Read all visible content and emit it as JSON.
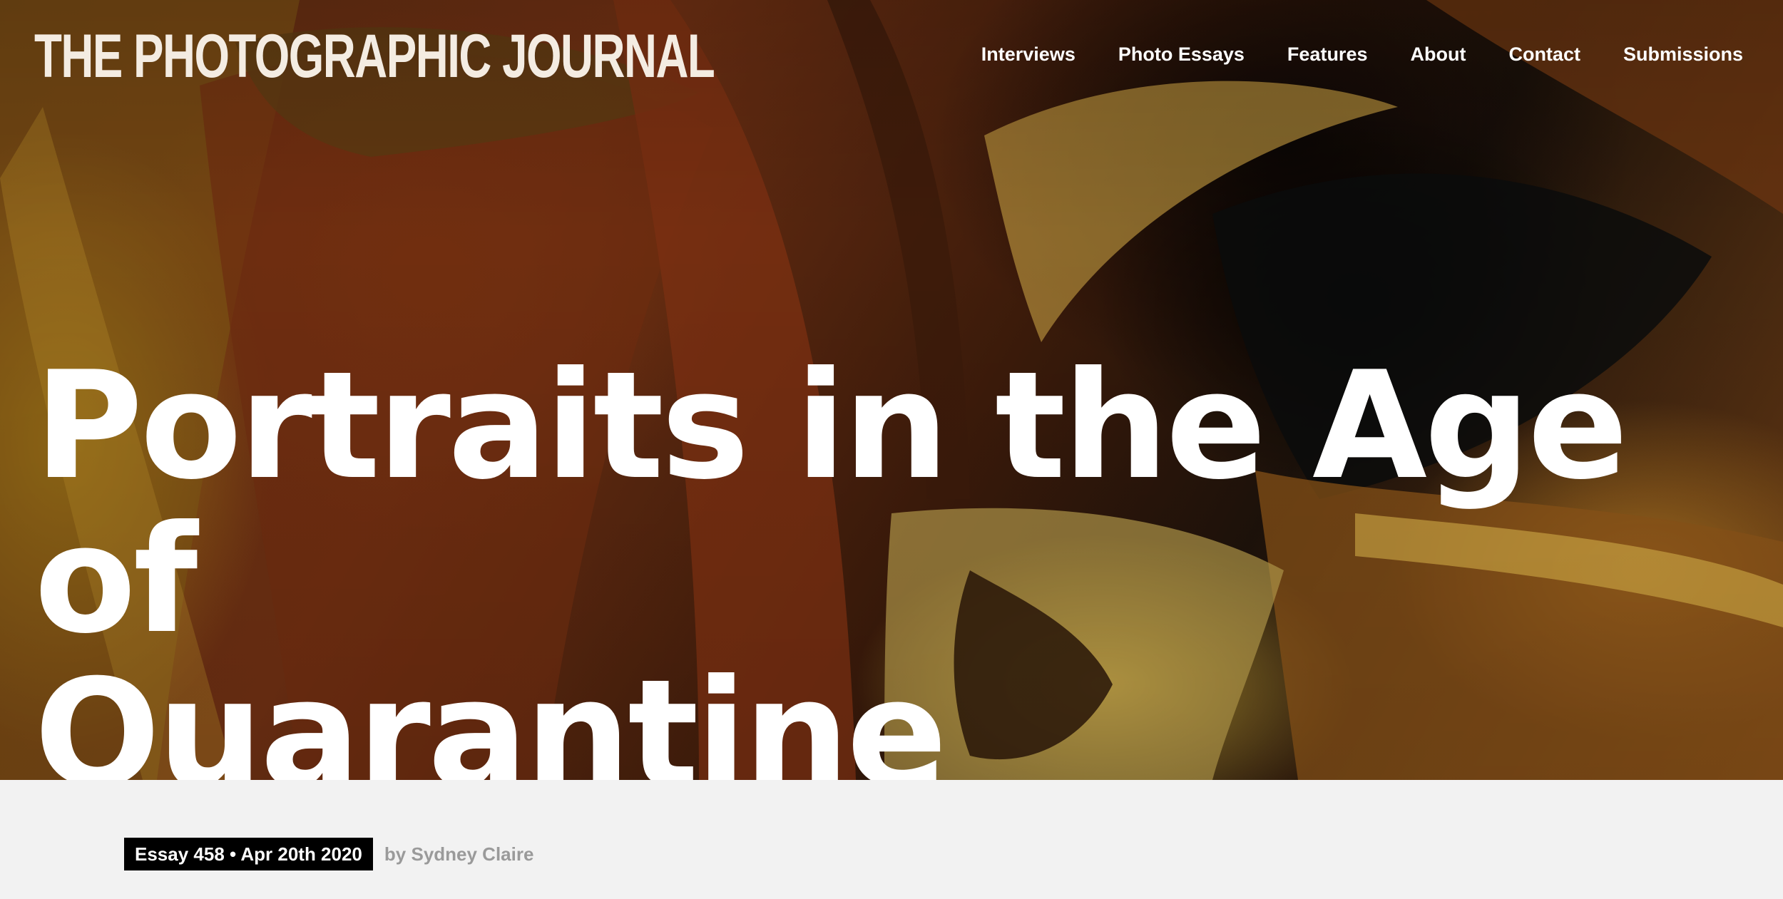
{
  "header": {
    "site_title": "THE PHOTOGRAPHIC JOURNAL",
    "nav": [
      {
        "label": "Interviews"
      },
      {
        "label": "Photo Essays"
      },
      {
        "label": "Features"
      },
      {
        "label": "About"
      },
      {
        "label": "Contact"
      },
      {
        "label": "Submissions"
      }
    ]
  },
  "hero": {
    "title_line_1": "Portraits in the Age of",
    "title_line_2": "Quarantine"
  },
  "meta": {
    "essay_tag": "Essay 458 • Apr 20th 2020",
    "byline": "by Sydney Claire"
  },
  "colors": {
    "page_background": "#f2f2f2",
    "tag_background": "#000000",
    "byline_text": "#9a9a9a",
    "hero_text": "#ffffff"
  }
}
